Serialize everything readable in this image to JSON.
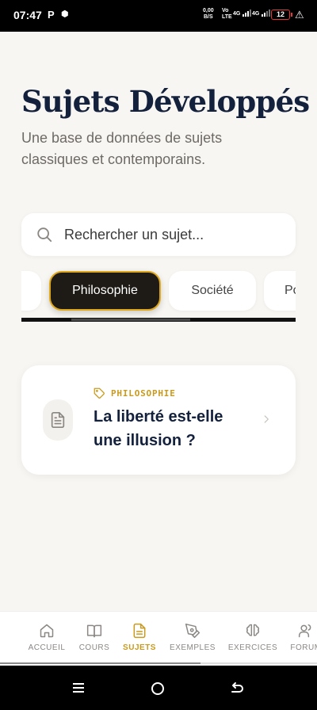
{
  "status_bar": {
    "time": "07:47",
    "app_icon_text": "P",
    "net_speed_value": "0,00",
    "net_speed_unit": "B/S",
    "volte_top": "Vo",
    "volte_bottom": "LTE",
    "sim1_label": "4G",
    "sim2_label": "4G",
    "battery": "12"
  },
  "header": {
    "title": "Sujets Développés",
    "subtitle": "Une base de données de sujets classiques et contemporains."
  },
  "search": {
    "placeholder": "Rechercher un sujet..."
  },
  "categories": [
    {
      "label": "",
      "active": false
    },
    {
      "label": "Philosophie",
      "active": true
    },
    {
      "label": "Société",
      "active": false
    },
    {
      "label": "Po",
      "active": false
    }
  ],
  "subject_card": {
    "tag": "PHILOSOPHIE",
    "title": "La liberté est-elle une illusion ?",
    "icon": "document-icon"
  },
  "bottom_nav": {
    "items": [
      {
        "label": "ACCUEIL",
        "icon": "home-icon",
        "active": false
      },
      {
        "label": "COURS",
        "icon": "book-icon",
        "active": false
      },
      {
        "label": "SUJETS",
        "icon": "document-icon",
        "active": true
      },
      {
        "label": "EXEMPLES",
        "icon": "pen-icon",
        "active": false
      },
      {
        "label": "EXERCICES",
        "icon": "brain-icon",
        "active": false
      },
      {
        "label": "FORUM",
        "icon": "users-icon",
        "active": false
      }
    ]
  },
  "colors": {
    "accent": "#c99a1d",
    "title": "#14213d",
    "background": "#f8f6f2",
    "chip_active": "#1e1b16"
  }
}
